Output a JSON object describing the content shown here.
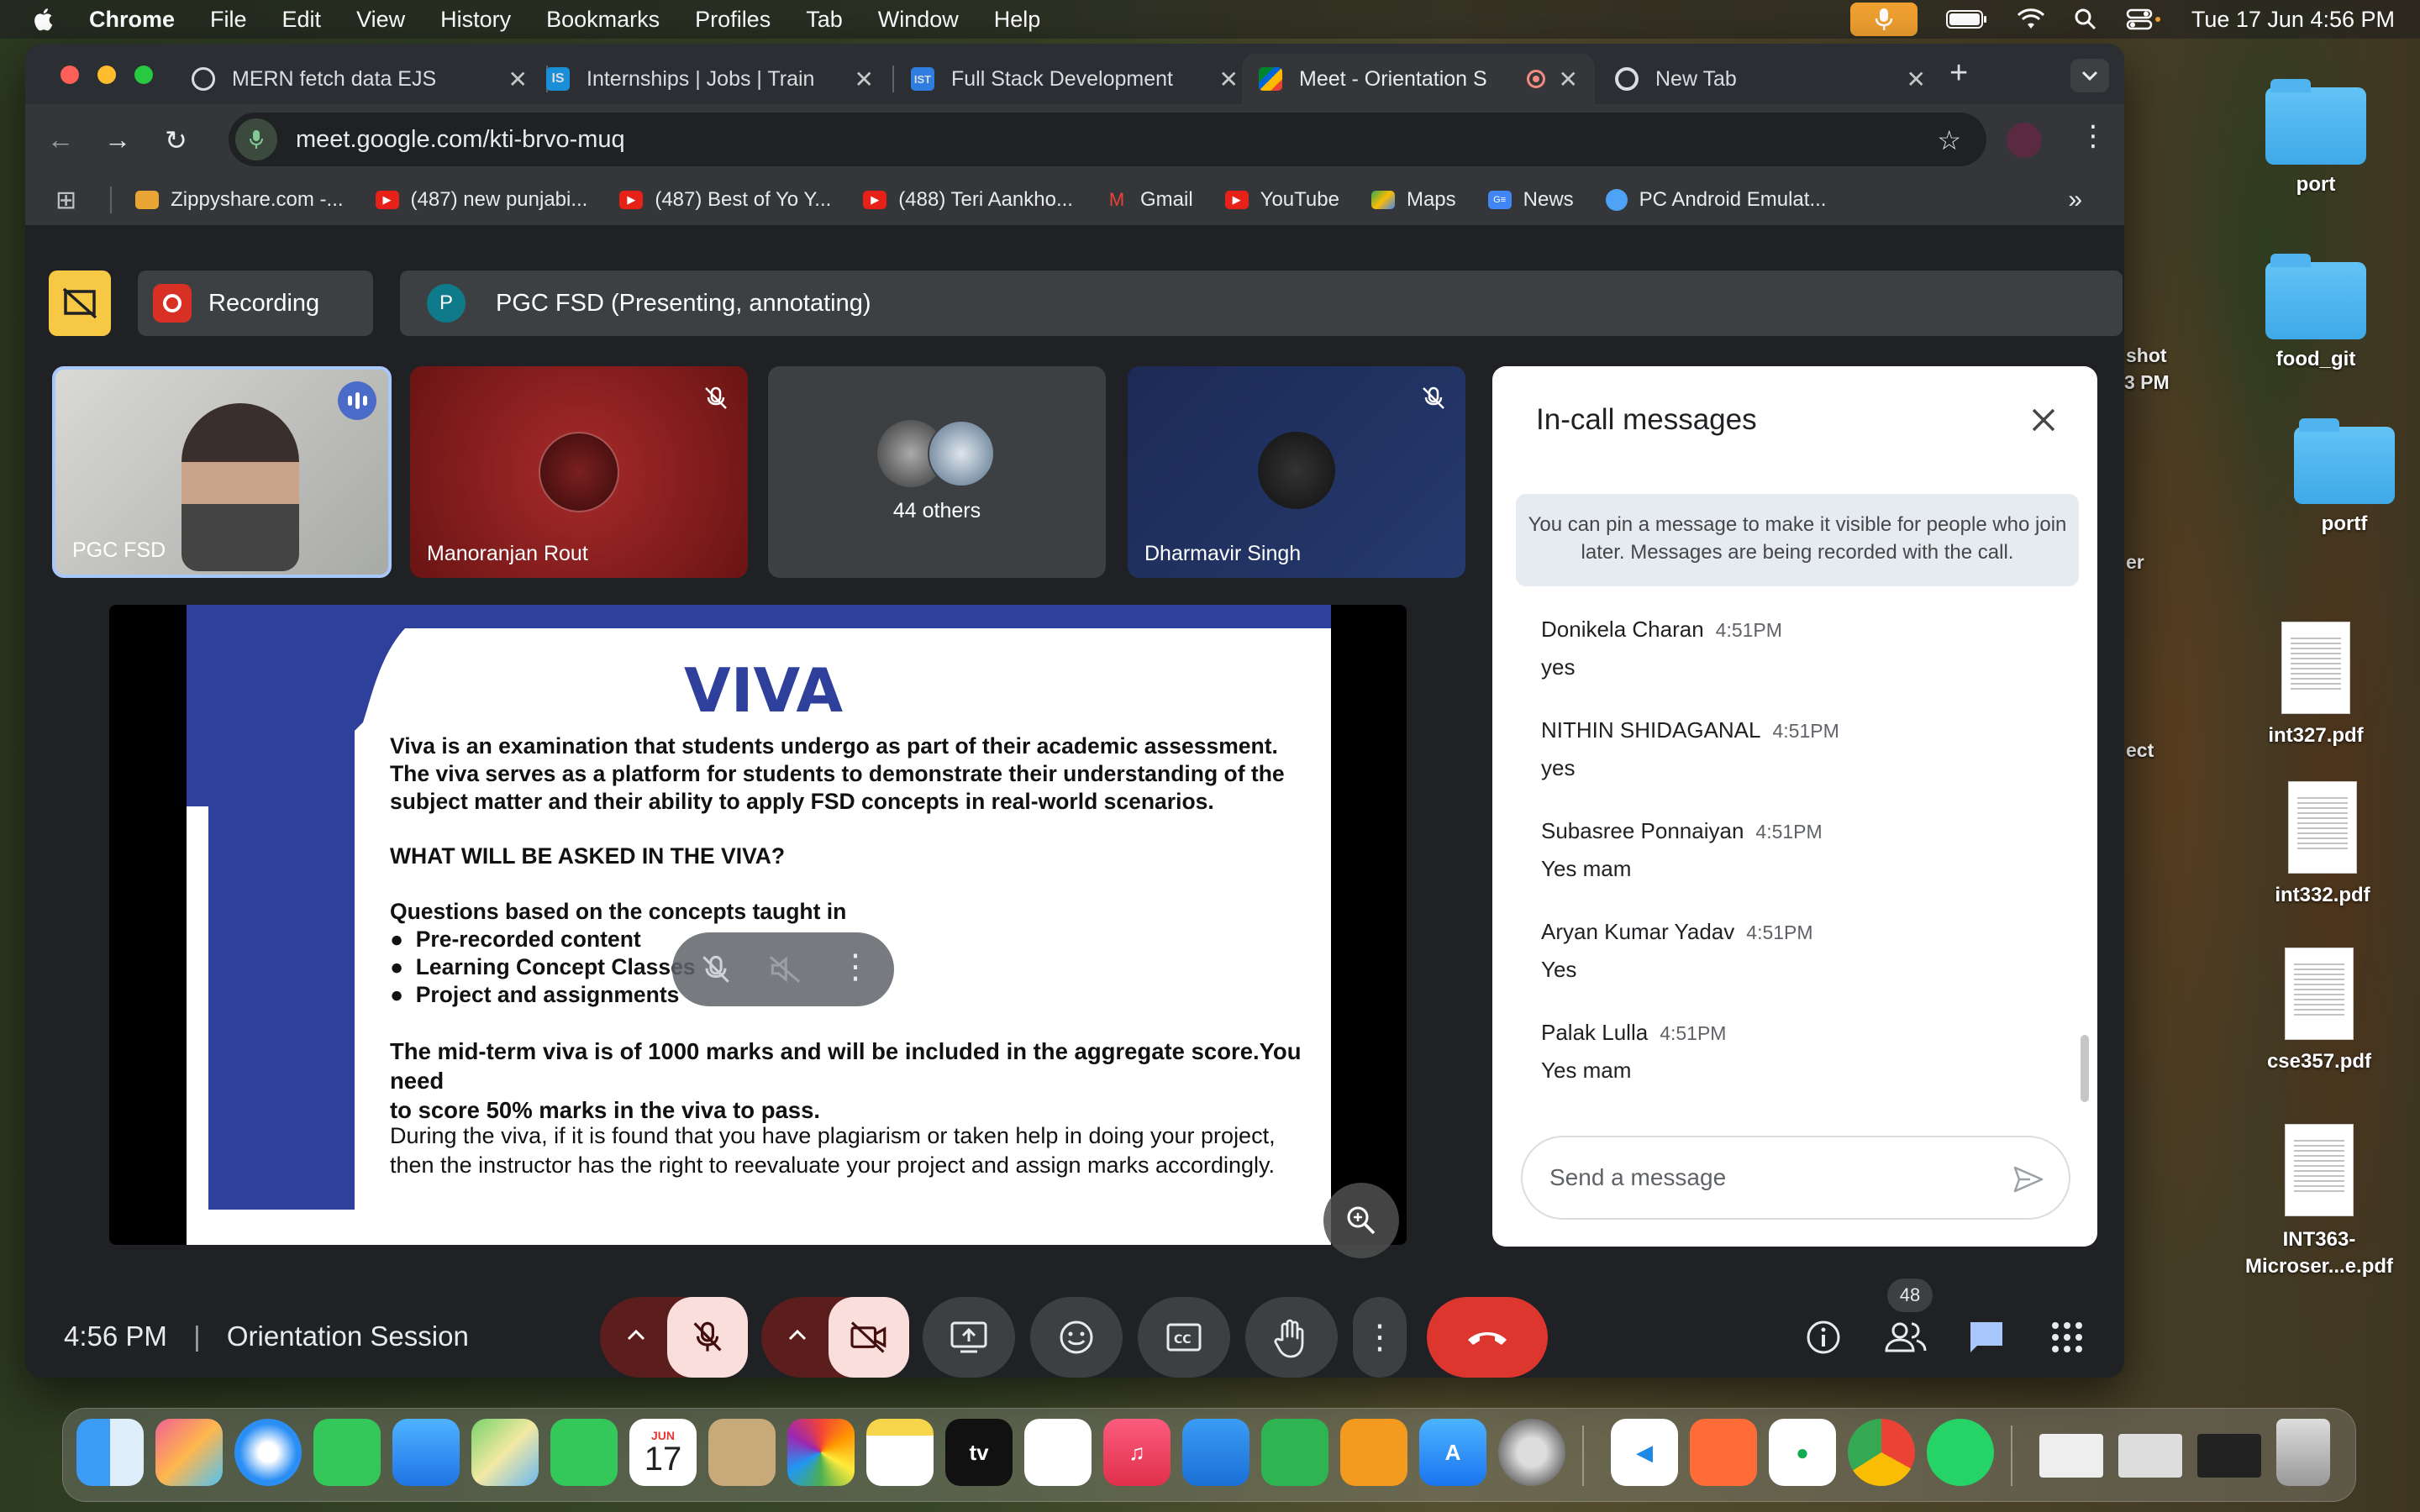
{
  "menubar": {
    "app_name": "Chrome",
    "items": [
      "File",
      "Edit",
      "View",
      "History",
      "Bookmarks",
      "Profiles",
      "Tab",
      "Window",
      "Help"
    ],
    "datetime": "Tue 17 Jun  4:56 PM"
  },
  "tabs": [
    {
      "title": "MERN fetch data EJS",
      "icon": "openai-icon"
    },
    {
      "title": "Internships | Jobs | Train",
      "icon": "internshala-icon"
    },
    {
      "title": "Full Stack Development",
      "icon": "ist-icon"
    },
    {
      "title": "Meet - Orientation S",
      "icon": "meet-icon",
      "active": true
    },
    {
      "title": "New Tab",
      "icon": "chrome-icon"
    }
  ],
  "omnibox": {
    "url": "meet.google.com/kti-brvo-muq"
  },
  "bookmarks": [
    {
      "label": "Zippyshare.com -...",
      "icon": "zippyshare-icon"
    },
    {
      "label": "(487) new punjabi...",
      "icon": "youtube-icon"
    },
    {
      "label": "(487) Best of Yo Y...",
      "icon": "youtube-icon"
    },
    {
      "label": "(488) Teri Aankho...",
      "icon": "youtube-icon"
    },
    {
      "label": "Gmail",
      "icon": "gmail-icon"
    },
    {
      "label": "YouTube",
      "icon": "youtube-icon"
    },
    {
      "label": "Maps",
      "icon": "maps-icon"
    },
    {
      "label": "News",
      "icon": "news-icon"
    },
    {
      "label": "PC Android Emulat...",
      "icon": "emulator-icon"
    }
  ],
  "meet": {
    "recording_label": "Recording",
    "presenter_initial": "P",
    "presenter_label": "PGC FSD (Presenting, annotating)",
    "participants": [
      {
        "name": "PGC FSD"
      },
      {
        "name": "Manoranjan Rout"
      },
      {
        "name": "44 others"
      },
      {
        "name": "Dharmavir Singh"
      }
    ],
    "meeting_time": "4:56 PM",
    "meeting_title": "Orientation Session",
    "people_count": "48"
  },
  "slide": {
    "title": "VIVA",
    "intro": [
      "Viva is an examination that students undergo as part of their academic assessment.",
      "The viva serves as a platform for students to demonstrate their understanding of the",
      "subject matter and their ability to apply FSD concepts in real-world scenarios."
    ],
    "question_heading": "WHAT WILL BE ASKED IN THE VIVA?",
    "questions_intro": "Questions based on the concepts taught in",
    "bullets": [
      "Pre-recorded content",
      "Learning Concept Classes",
      "Project and assignments"
    ],
    "midterm": [
      "The mid-term viva is of 1000 marks and will be included in the aggregate score.You need",
      "to score 50% marks in the viva to pass."
    ],
    "plagiarism": [
      "During the viva, if it is found that you have plagiarism or taken help in doing your project,",
      "then the instructor has the right to reevaluate your project and assign marks accordingly."
    ]
  },
  "chat": {
    "title": "In-call messages",
    "pin_note": "You can pin a message to make it visible for people who join later. Messages are being recorded with the call.",
    "messages": [
      {
        "sender": "Donikela Charan",
        "time": "4:51PM",
        "body": "yes"
      },
      {
        "sender": "NITHIN SHIDAGANAL",
        "time": "4:51PM",
        "body": "yes"
      },
      {
        "sender": "Subasree Ponnaiyan",
        "time": "4:51PM",
        "body": "Yes mam"
      },
      {
        "sender": "Aryan Kumar Yadav",
        "time": "4:51PM",
        "body": "Yes"
      },
      {
        "sender": "Palak Lulla",
        "time": "4:51PM",
        "body": "Yes mam"
      }
    ],
    "input_placeholder": "Send a message"
  },
  "desktop": {
    "items": [
      {
        "label": "port",
        "kind": "folder"
      },
      {
        "label": "food_git",
        "kind": "folder"
      },
      {
        "label": "portf",
        "kind": "folder"
      },
      {
        "label": "int327.pdf",
        "kind": "pdf"
      },
      {
        "label": "int332.pdf",
        "kind": "pdf"
      },
      {
        "label": "cse357.pdf",
        "kind": "pdf"
      },
      {
        "label": "INT363-Microser...e.pdf",
        "kind": "pdf"
      }
    ],
    "partial_labels": [
      "shot",
      "3 PM",
      "er",
      "ect"
    ]
  },
  "dock": {
    "calendar_month": "JUN",
    "calendar_day": "17",
    "tv_label": "tv"
  },
  "colors": {
    "meet_bg": "#202124",
    "slide_blue": "#2e3f9c",
    "end_call_red": "#dc362e",
    "recording_red": "#d93025",
    "presenting_yellow": "#f7c844"
  }
}
